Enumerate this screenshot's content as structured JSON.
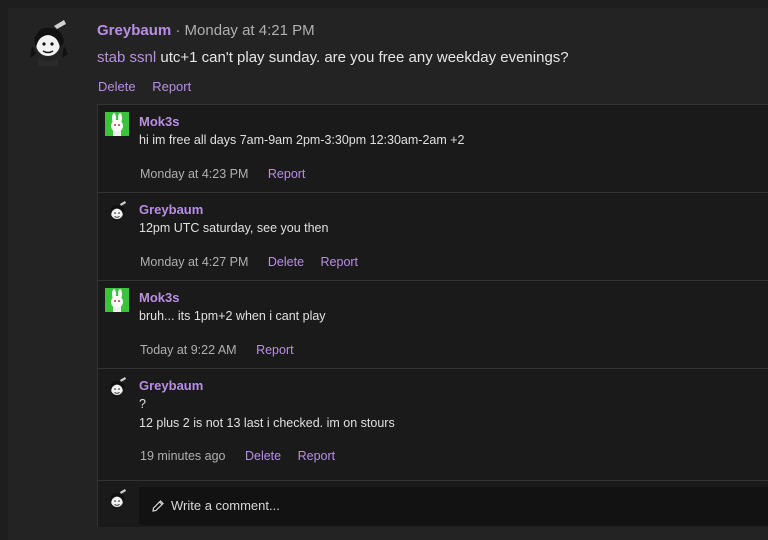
{
  "post": {
    "author": "Greybaum",
    "separator": "·",
    "time": "Monday at 4:21 PM",
    "mention": "stab ssnl",
    "text": "utc+1 can't play sunday. are you free any weekday evenings?",
    "actions": {
      "delete": "Delete",
      "report": "Report"
    }
  },
  "comments": [
    {
      "author": "Mok3s",
      "lines": [
        "hi im free all days 7am-9am 2pm-3:30pm 12:30am-2am +2"
      ],
      "time": "Monday at 4:23 PM",
      "report": "Report",
      "avatar": "green-bunny"
    },
    {
      "author": "Greybaum",
      "lines": [
        "12pm UTC saturday, see you then"
      ],
      "time": "Monday at 4:27 PM",
      "delete": "Delete",
      "report": "Report",
      "avatar": "greybaum"
    },
    {
      "author": "Mok3s",
      "lines": [
        "bruh... its 1pm+2 when i cant play"
      ],
      "time": "Today at 9:22 AM",
      "report": "Report",
      "avatar": "green-bunny"
    },
    {
      "author": "Greybaum",
      "lines": [
        "?",
        "12 plus 2 is not 13 last i checked. im on stours"
      ],
      "time": "19 minutes ago",
      "delete": "Delete",
      "report": "Report",
      "avatar": "greybaum"
    }
  ],
  "compose": {
    "placeholder": "Write a comment...",
    "icon": "pencil-icon"
  },
  "colors": {
    "accent": "#b98ee6",
    "background": "#1e1e1e",
    "panel": "#1a1a1a"
  }
}
